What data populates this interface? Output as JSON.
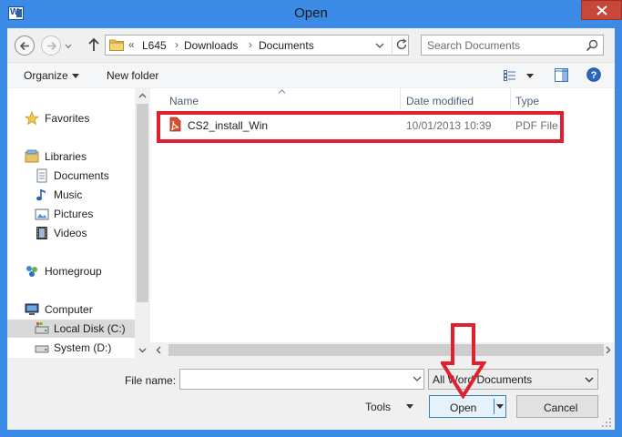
{
  "window": {
    "title": "Open",
    "app_icon_letter": "W"
  },
  "address": {
    "overflow": "«",
    "crumbs": [
      "L645",
      "Downloads",
      "Documents"
    ]
  },
  "search": {
    "placeholder": "Search Documents"
  },
  "toolbar": {
    "organize": "Organize",
    "new_folder": "New folder"
  },
  "nav": {
    "favorites": "Favorites",
    "libraries": "Libraries",
    "documents": "Documents",
    "music": "Music",
    "pictures": "Pictures",
    "videos": "Videos",
    "homegroup": "Homegroup",
    "computer": "Computer",
    "local_disk": "Local Disk (C:)",
    "system": "System (D:)"
  },
  "columns": {
    "name": "Name",
    "date_modified": "Date modified",
    "type": "Type"
  },
  "files": [
    {
      "name": "CS2_install_Win",
      "date": "10/01/2013 10:39",
      "type": "PDF File"
    }
  ],
  "bottom": {
    "file_name_label": "File name:",
    "file_name_value": "",
    "filter": "All Word Documents",
    "tools": "Tools",
    "open": "Open",
    "cancel": "Cancel"
  },
  "colors": {
    "titlebar": "#3b8ae5",
    "close": "#c7473a",
    "annotation": "#e0202e"
  },
  "icons": [
    "word-app-icon",
    "close-icon",
    "back-icon",
    "forward-icon",
    "up-icon",
    "folder-icon",
    "refresh-icon",
    "search-icon",
    "view-icon",
    "preview-pane-icon",
    "help-icon",
    "star-icon",
    "pdf-icon"
  ]
}
